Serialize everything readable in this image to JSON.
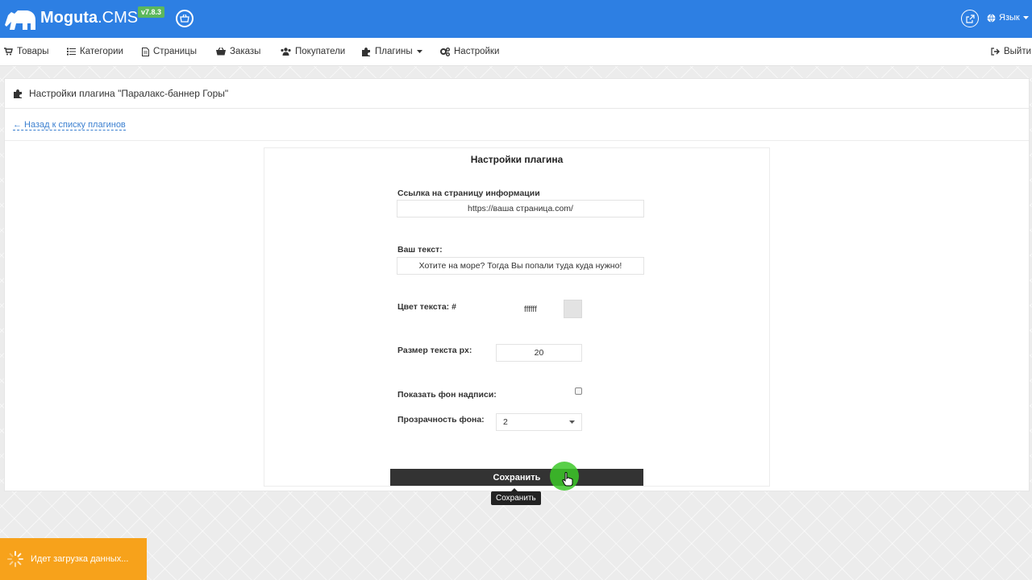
{
  "header": {
    "logo_name": "Moguta",
    "logo_suffix": ".CMS",
    "version": "v7.8.3",
    "language_label": "Язык"
  },
  "nav": {
    "items": [
      {
        "label": "Товары",
        "icon": "cart-icon"
      },
      {
        "label": "Категории",
        "icon": "list-icon"
      },
      {
        "label": "Страницы",
        "icon": "file-icon"
      },
      {
        "label": "Заказы",
        "icon": "basket-icon"
      },
      {
        "label": "Покупатели",
        "icon": "users-icon"
      },
      {
        "label": "Плагины",
        "icon": "puzzle-icon"
      },
      {
        "label": "Настройки",
        "icon": "gears-icon"
      }
    ],
    "logout_label": "Выйти"
  },
  "page": {
    "title": "Настройки плагина \"Паралакс-баннер Горы\"",
    "back_link": "← Назад к списку плагинов"
  },
  "form": {
    "title": "Настройки плагина",
    "link_label": "Ссылка на страницу информации",
    "link_value": "https://ваша страница.com/",
    "text_label": "Ваш текст:",
    "text_value": "Хотите на море? Тогда Вы попали туда куда нужно!",
    "color_label": "Цвет текста: #",
    "color_value": "ffffff",
    "size_label": "Размер текста px:",
    "size_value": "20",
    "bg_label": "Показать фон надписи:",
    "bg_checked": false,
    "opacity_label": "Прозрачность фона:",
    "opacity_value": "2",
    "save_label": "Сохранить",
    "tooltip": "Сохранить"
  },
  "status": {
    "loading_text": "Идет загрузка данных..."
  },
  "colors": {
    "header_blue": "#2d7fe3",
    "version_badge": "#5cb85c",
    "loader_orange": "#f7a21b",
    "link_blue": "#3a7fd0",
    "save_button": "#333333",
    "click_highlight": "#3cc828"
  }
}
